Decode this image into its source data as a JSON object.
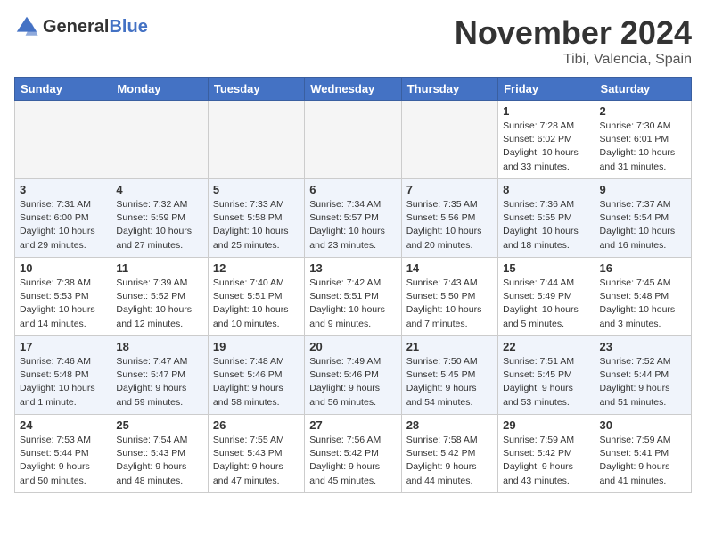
{
  "header": {
    "logo_general": "General",
    "logo_blue": "Blue",
    "month": "November 2024",
    "location": "Tibi, Valencia, Spain"
  },
  "weekdays": [
    "Sunday",
    "Monday",
    "Tuesday",
    "Wednesday",
    "Thursday",
    "Friday",
    "Saturday"
  ],
  "weeks": [
    [
      {
        "day": "",
        "info": ""
      },
      {
        "day": "",
        "info": ""
      },
      {
        "day": "",
        "info": ""
      },
      {
        "day": "",
        "info": ""
      },
      {
        "day": "",
        "info": ""
      },
      {
        "day": "1",
        "info": "Sunrise: 7:28 AM\nSunset: 6:02 PM\nDaylight: 10 hours\nand 33 minutes."
      },
      {
        "day": "2",
        "info": "Sunrise: 7:30 AM\nSunset: 6:01 PM\nDaylight: 10 hours\nand 31 minutes."
      }
    ],
    [
      {
        "day": "3",
        "info": "Sunrise: 7:31 AM\nSunset: 6:00 PM\nDaylight: 10 hours\nand 29 minutes."
      },
      {
        "day": "4",
        "info": "Sunrise: 7:32 AM\nSunset: 5:59 PM\nDaylight: 10 hours\nand 27 minutes."
      },
      {
        "day": "5",
        "info": "Sunrise: 7:33 AM\nSunset: 5:58 PM\nDaylight: 10 hours\nand 25 minutes."
      },
      {
        "day": "6",
        "info": "Sunrise: 7:34 AM\nSunset: 5:57 PM\nDaylight: 10 hours\nand 23 minutes."
      },
      {
        "day": "7",
        "info": "Sunrise: 7:35 AM\nSunset: 5:56 PM\nDaylight: 10 hours\nand 20 minutes."
      },
      {
        "day": "8",
        "info": "Sunrise: 7:36 AM\nSunset: 5:55 PM\nDaylight: 10 hours\nand 18 minutes."
      },
      {
        "day": "9",
        "info": "Sunrise: 7:37 AM\nSunset: 5:54 PM\nDaylight: 10 hours\nand 16 minutes."
      }
    ],
    [
      {
        "day": "10",
        "info": "Sunrise: 7:38 AM\nSunset: 5:53 PM\nDaylight: 10 hours\nand 14 minutes."
      },
      {
        "day": "11",
        "info": "Sunrise: 7:39 AM\nSunset: 5:52 PM\nDaylight: 10 hours\nand 12 minutes."
      },
      {
        "day": "12",
        "info": "Sunrise: 7:40 AM\nSunset: 5:51 PM\nDaylight: 10 hours\nand 10 minutes."
      },
      {
        "day": "13",
        "info": "Sunrise: 7:42 AM\nSunset: 5:51 PM\nDaylight: 10 hours\nand 9 minutes."
      },
      {
        "day": "14",
        "info": "Sunrise: 7:43 AM\nSunset: 5:50 PM\nDaylight: 10 hours\nand 7 minutes."
      },
      {
        "day": "15",
        "info": "Sunrise: 7:44 AM\nSunset: 5:49 PM\nDaylight: 10 hours\nand 5 minutes."
      },
      {
        "day": "16",
        "info": "Sunrise: 7:45 AM\nSunset: 5:48 PM\nDaylight: 10 hours\nand 3 minutes."
      }
    ],
    [
      {
        "day": "17",
        "info": "Sunrise: 7:46 AM\nSunset: 5:48 PM\nDaylight: 10 hours\nand 1 minute."
      },
      {
        "day": "18",
        "info": "Sunrise: 7:47 AM\nSunset: 5:47 PM\nDaylight: 9 hours\nand 59 minutes."
      },
      {
        "day": "19",
        "info": "Sunrise: 7:48 AM\nSunset: 5:46 PM\nDaylight: 9 hours\nand 58 minutes."
      },
      {
        "day": "20",
        "info": "Sunrise: 7:49 AM\nSunset: 5:46 PM\nDaylight: 9 hours\nand 56 minutes."
      },
      {
        "day": "21",
        "info": "Sunrise: 7:50 AM\nSunset: 5:45 PM\nDaylight: 9 hours\nand 54 minutes."
      },
      {
        "day": "22",
        "info": "Sunrise: 7:51 AM\nSunset: 5:45 PM\nDaylight: 9 hours\nand 53 minutes."
      },
      {
        "day": "23",
        "info": "Sunrise: 7:52 AM\nSunset: 5:44 PM\nDaylight: 9 hours\nand 51 minutes."
      }
    ],
    [
      {
        "day": "24",
        "info": "Sunrise: 7:53 AM\nSunset: 5:44 PM\nDaylight: 9 hours\nand 50 minutes."
      },
      {
        "day": "25",
        "info": "Sunrise: 7:54 AM\nSunset: 5:43 PM\nDaylight: 9 hours\nand 48 minutes."
      },
      {
        "day": "26",
        "info": "Sunrise: 7:55 AM\nSunset: 5:43 PM\nDaylight: 9 hours\nand 47 minutes."
      },
      {
        "day": "27",
        "info": "Sunrise: 7:56 AM\nSunset: 5:42 PM\nDaylight: 9 hours\nand 45 minutes."
      },
      {
        "day": "28",
        "info": "Sunrise: 7:58 AM\nSunset: 5:42 PM\nDaylight: 9 hours\nand 44 minutes."
      },
      {
        "day": "29",
        "info": "Sunrise: 7:59 AM\nSunset: 5:42 PM\nDaylight: 9 hours\nand 43 minutes."
      },
      {
        "day": "30",
        "info": "Sunrise: 7:59 AM\nSunset: 5:41 PM\nDaylight: 9 hours\nand 41 minutes."
      }
    ]
  ]
}
